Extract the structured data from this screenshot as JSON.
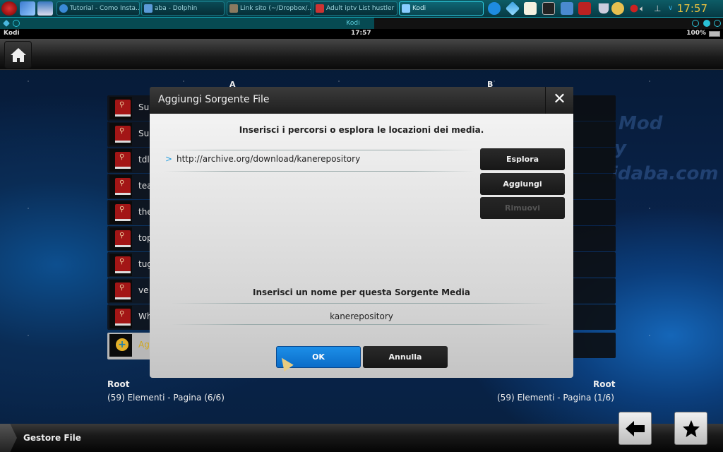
{
  "taskbar": {
    "tasks": [
      {
        "label": "Tutorial - Como Insta...",
        "icon": "browser-icon"
      },
      {
        "label": "aba - Dolphin",
        "icon": "dolphin-icon"
      },
      {
        "label": "Link sito (~/Dropbox/...",
        "icon": "editor-icon"
      },
      {
        "label": "Adult iptv List hustler ...",
        "icon": "app-icon"
      },
      {
        "label": "Kodi",
        "icon": "kodi-icon",
        "active": true
      }
    ],
    "clock": "17:57"
  },
  "subbar": {
    "window_title": "Kodi"
  },
  "kodi_status": {
    "app_name": "Kodi",
    "time": "17:57",
    "battery": "100%"
  },
  "file_manager": {
    "column_a_label": "A",
    "column_b_label": "B",
    "left_items": [
      {
        "name": "Su"
      },
      {
        "name": "Su"
      },
      {
        "name": "tdl"
      },
      {
        "name": "tea"
      },
      {
        "name": "the"
      },
      {
        "name": "top"
      },
      {
        "name": "tug"
      },
      {
        "name": "ve"
      },
      {
        "name": "Wh"
      },
      {
        "name": "Ag",
        "selected": true,
        "type": "add-source"
      }
    ],
    "left_footer": {
      "path": "Root",
      "info": "(59) Elementi - Pagina (6/6)"
    },
    "right_footer": {
      "path": "Root",
      "info": "(59) Elementi - Pagina (1/6)"
    },
    "watermark": [
      "Mod",
      "y",
      "idaba.com"
    ],
    "section_title": "Gestore File"
  },
  "dialog": {
    "title": "Aggiungi Sorgente File",
    "paths_heading": "Inserisci i percorsi o esplora le locazioni dei media.",
    "paths": [
      "http://archive.org/download/kanerepository"
    ],
    "buttons": {
      "browse": "Esplora",
      "add": "Aggiungi",
      "remove": "Rimuovi"
    },
    "name_heading": "Inserisci un nome per questa Sorgente Media",
    "name_value": "kanerepository",
    "ok": "OK",
    "cancel": "Annulla"
  }
}
